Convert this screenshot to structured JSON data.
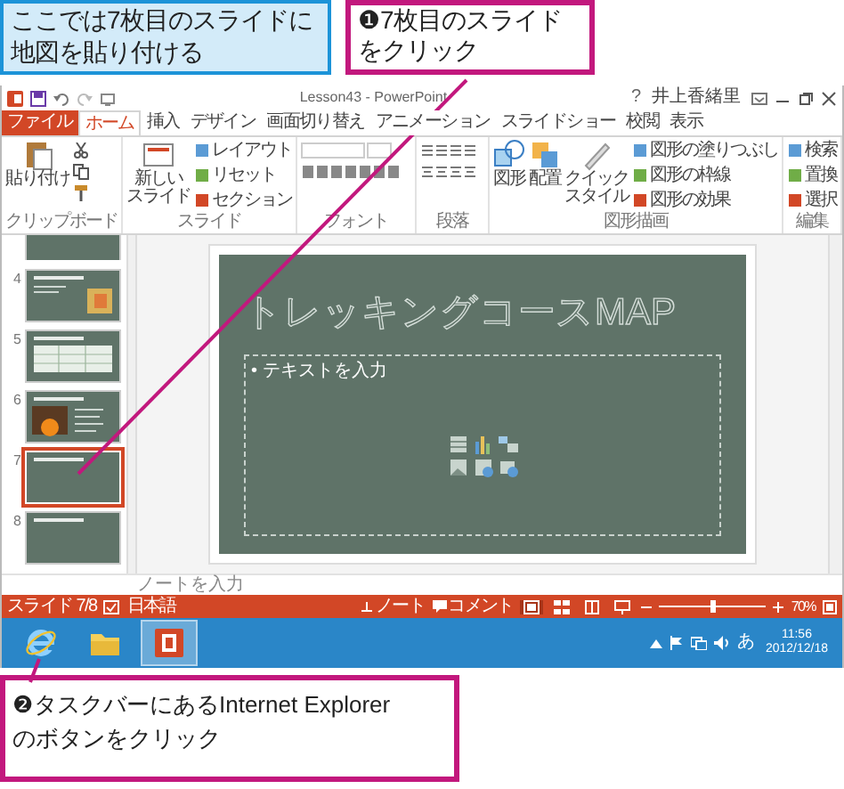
{
  "annotations_top": [
    {
      "kind": "info",
      "lines": [
        "ここでは7枚目のスライドに",
        "地図を貼り付ける"
      ]
    },
    {
      "kind": "step",
      "lines": [
        "❶7枚目のスライド",
        "をクリック"
      ]
    }
  ],
  "window": {
    "title": "Lesson43 - PowerPoint",
    "help": "?",
    "user": "井上香緒里"
  },
  "tabs": [
    {
      "label": "ファイル",
      "kind": "file",
      "selected": false
    },
    {
      "label": "ホーム",
      "kind": "tab",
      "selected": true
    },
    {
      "label": "挿入",
      "kind": "tab",
      "selected": false
    },
    {
      "label": "デザイン",
      "kind": "tab",
      "selected": false
    },
    {
      "label": "画面切り替え",
      "kind": "tab",
      "selected": false
    },
    {
      "label": "アニメーション",
      "kind": "tab",
      "selected": false
    },
    {
      "label": "スライドショー",
      "kind": "tab",
      "selected": false
    },
    {
      "label": "校閲",
      "kind": "tab",
      "selected": false
    },
    {
      "label": "表示",
      "kind": "tab",
      "selected": false
    }
  ],
  "ribbon": [
    {
      "label": "クリップボード",
      "kind": "clipboard",
      "buttons": [
        {
          "label": "貼り付け",
          "kind": "large"
        }
      ]
    },
    {
      "label": "スライド",
      "kind": "slides",
      "buttons": [
        {
          "label": [
            "新しい",
            "スライド"
          ],
          "kind": "large"
        },
        {
          "label": "レイアウト",
          "kind": "small"
        },
        {
          "label": "リセット",
          "kind": "small"
        },
        {
          "label": "セクション",
          "kind": "small"
        }
      ]
    },
    {
      "label": "フォント",
      "kind": "font"
    },
    {
      "label": "段落",
      "kind": "paragraph"
    },
    {
      "label": "図形描画",
      "kind": "drawing",
      "buttons": [
        {
          "label": "図形",
          "kind": "large"
        },
        {
          "label": "配置",
          "kind": "large"
        },
        {
          "label": [
            "クイック",
            "スタイル"
          ],
          "kind": "large"
        },
        {
          "label": "図形の塗りつぶし",
          "kind": "small"
        },
        {
          "label": "図形の枠線",
          "kind": "small"
        },
        {
          "label": "図形の効果",
          "kind": "small"
        }
      ]
    },
    {
      "label": "編集",
      "kind": "editing",
      "buttons": [
        {
          "label": "検索",
          "kind": "small"
        },
        {
          "label": "置換",
          "kind": "small"
        },
        {
          "label": "選択",
          "kind": "small"
        }
      ]
    }
  ],
  "slides": [
    {
      "kind": "picture",
      "partial": true,
      "selected": false
    },
    {
      "kind": "text-picture",
      "number": "4",
      "partial": false,
      "selected": false
    },
    {
      "kind": "table",
      "number": "5",
      "partial": false,
      "selected": false
    },
    {
      "kind": "photo-bullets",
      "number": "6",
      "partial": false,
      "selected": false
    },
    {
      "kind": "title",
      "number": "7",
      "partial": false,
      "selected": true
    },
    {
      "kind": "title",
      "number": "8",
      "partial": false,
      "selected": false
    }
  ],
  "slide": {
    "title": "トレッキングコースMAP",
    "body": "• テキストを入力"
  },
  "notes_placeholder": "ノートを入力",
  "status_bar": {
    "slide": "スライド 7/8",
    "language": "日本語",
    "notes": "ノート",
    "comments": "コメント",
    "views": [
      {
        "kind": "normal",
        "selected": true
      },
      {
        "kind": "sorter",
        "selected": false
      },
      {
        "kind": "reading",
        "selected": false
      },
      {
        "kind": "show",
        "selected": false
      }
    ],
    "zoom": {
      "level": 0.5
    },
    "zoom_text": "70%"
  },
  "taskbar": {
    "apps": [
      {
        "kind": "ie",
        "selected": false
      },
      {
        "kind": "explorer",
        "selected": false
      },
      {
        "kind": "powerpoint",
        "selected": true
      }
    ],
    "ime": "あ",
    "time": "11:56",
    "date": "2012/12/18"
  },
  "annotation_bottom": {
    "kind": "step",
    "lines": [
      "❷タスクバーにあるInternet Explorer",
      "のボタンをクリック"
    ]
  }
}
